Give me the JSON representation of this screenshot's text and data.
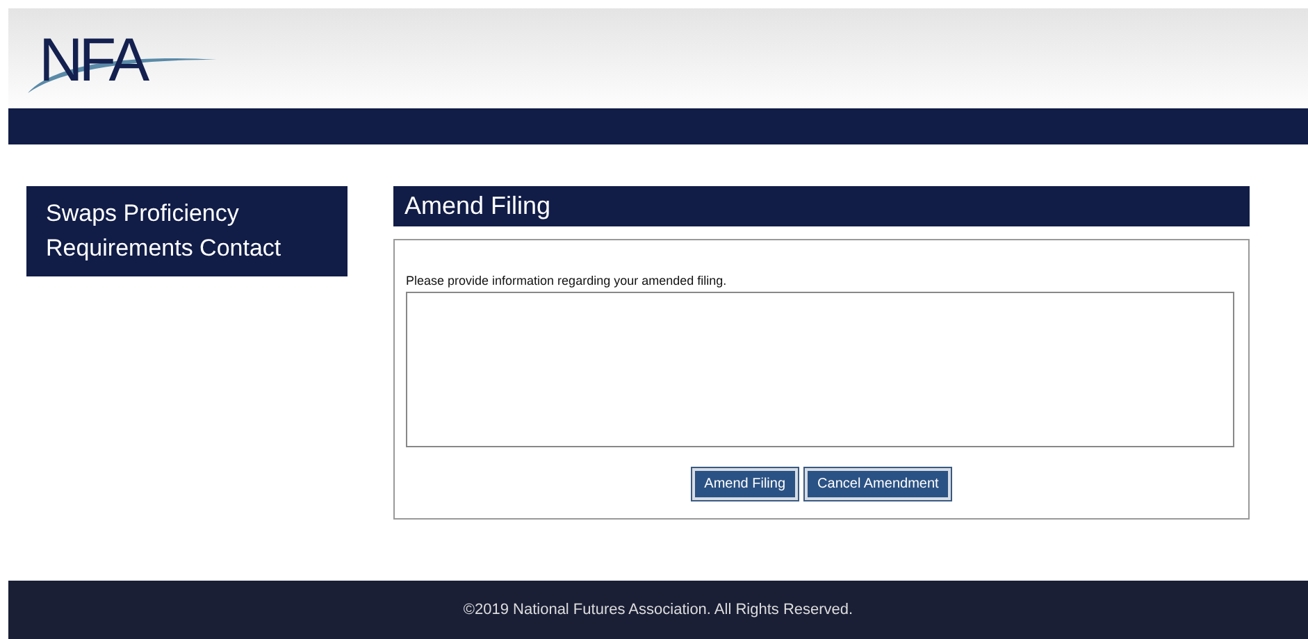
{
  "header": {
    "logo": "NFA"
  },
  "sidebar": {
    "title": "Swaps Proficiency Requirements Contact"
  },
  "panel": {
    "title": "Amend Filing",
    "prompt": "Please provide information regarding your amended filing.",
    "buttons": [
      "Amend Filing",
      "Cancel Amendment"
    ]
  },
  "footer": {
    "text": "©2019 National Futures Association. All Rights Reserved."
  }
}
